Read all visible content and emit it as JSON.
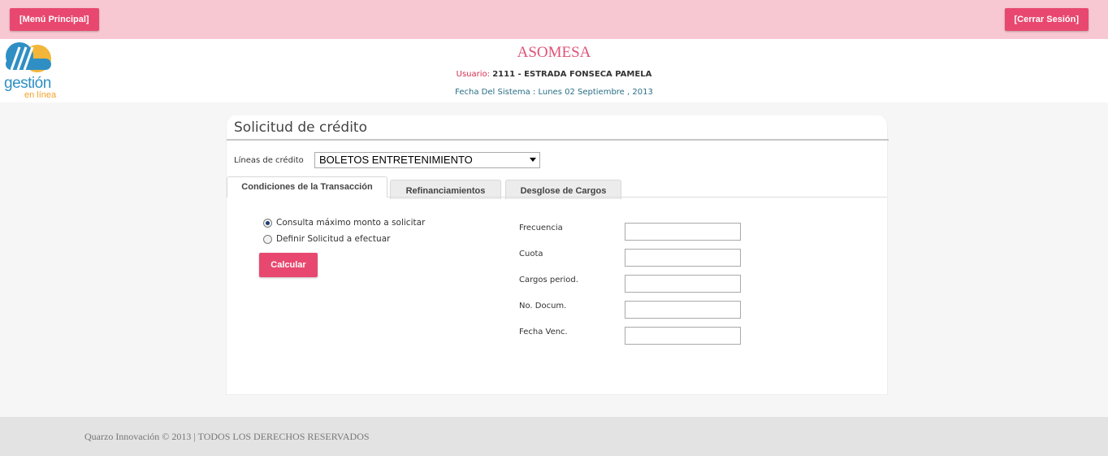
{
  "topbar": {
    "menu_button": "[Menú Principal]",
    "logout_button": "[Cerrar Sesión]"
  },
  "logo": {
    "text": "gestión",
    "subtext": "en línea"
  },
  "header": {
    "company": "ASOMESA",
    "user_label": "Usuario:",
    "user_value": "2111 - ESTRADA FONSECA PAMELA",
    "system_date": "Fecha Del Sistema : Lunes 02 Septiembre , 2013"
  },
  "form": {
    "title": "Solicitud de crédito",
    "credit_lines_label": "Líneas de crédito",
    "credit_line_selected": "BOLETOS ENTRETENIMIENTO",
    "tabs": [
      {
        "label": "Condiciones de la Transacción",
        "active": true
      },
      {
        "label": "Refinanciamientos",
        "active": false
      },
      {
        "label": "Desglose de Cargos",
        "active": false
      }
    ],
    "radios": [
      {
        "label": "Consulta máximo monto a solicitar",
        "checked": true
      },
      {
        "label": "Definir Solicitud a efectuar",
        "checked": false
      }
    ],
    "calculate_button": "Calcular",
    "fields": [
      {
        "label": "Frecuencia",
        "value": ""
      },
      {
        "label": "Cuota",
        "value": ""
      },
      {
        "label": "Cargos period.",
        "value": ""
      },
      {
        "label": "No. Docum.",
        "value": ""
      },
      {
        "label": "Fecha Venc.",
        "value": ""
      }
    ]
  },
  "footer": {
    "text": "Quarzo Innovación © 2013 | TODOS LOS DERECHOS RESERVADOS"
  },
  "colors": {
    "accent": "#e8486f",
    "topbar": "#f8c8d2",
    "logo_blue": "#2f8fc4",
    "logo_orange": "#f2a227"
  }
}
